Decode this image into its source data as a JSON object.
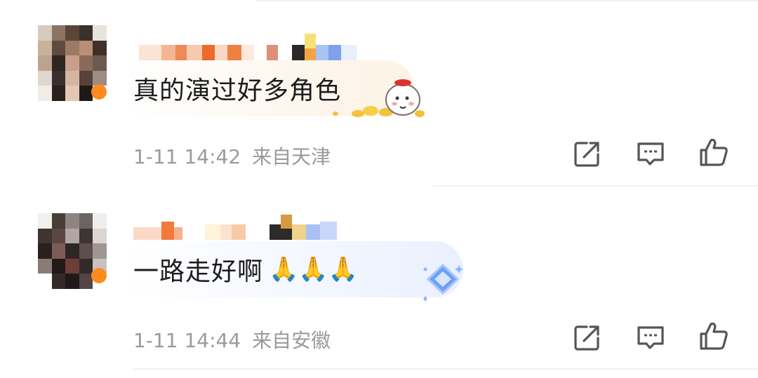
{
  "comments": [
    {
      "text": "真的演过好多角色",
      "time": "1-11 14:42",
      "location": "来自天津",
      "decoration": "fortune-doll-sticker"
    },
    {
      "text": "一路走好啊",
      "emoji": "🙏🙏🙏",
      "time": "1-11 14:44",
      "location": "来自安徽",
      "decoration": "diamond-badge-sticker"
    }
  ],
  "actions": [
    "share-icon",
    "comment-icon",
    "like-icon"
  ]
}
